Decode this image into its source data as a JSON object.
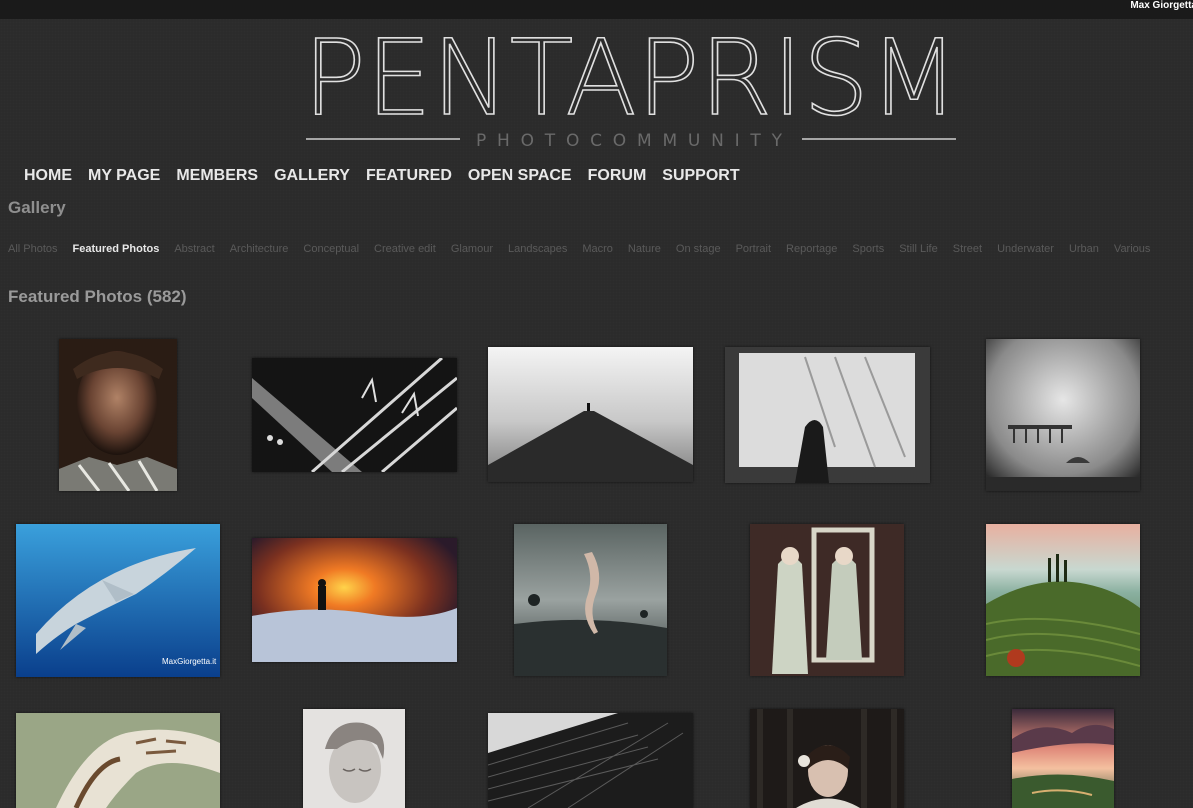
{
  "topbar": {
    "user_name": "Max Giorgetta"
  },
  "logo": {
    "brand": "PENTAPRISM",
    "tagline": "PHOTOCOMMUNITY"
  },
  "nav": {
    "items": [
      "HOME",
      "MY PAGE",
      "MEMBERS",
      "GALLERY",
      "FEATURED",
      "OPEN SPACE",
      "FORUM",
      "SUPPORT"
    ]
  },
  "gallery": {
    "title": "Gallery",
    "categories": [
      "All Photos",
      "Featured Photos",
      "Abstract",
      "Architecture",
      "Conceptual",
      "Creative edit",
      "Glamour",
      "Landscapes",
      "Macro",
      "Nature",
      "On stage",
      "Portrait",
      "Reportage",
      "Sports",
      "Still Life",
      "Street",
      "Underwater",
      "Urban",
      "Various"
    ],
    "active_category": "Featured Photos",
    "featured_title": "Featured Photos (582)"
  },
  "photos": [
    {
      "subject": "old-man-portrait"
    },
    {
      "subject": "street-arrows-bw"
    },
    {
      "subject": "pier-bw"
    },
    {
      "subject": "woman-frame-wall"
    },
    {
      "subject": "long-exposure-pier"
    },
    {
      "subject": "shark-underwater",
      "watermark": "MaxGiorgetta.it"
    },
    {
      "subject": "sunset-snow-photographer"
    },
    {
      "subject": "surreal-dancer-sea"
    },
    {
      "subject": "girls-mirror-frame"
    },
    {
      "subject": "tuscany-hills"
    },
    {
      "subject": "hawk-wings"
    },
    {
      "subject": "woman-portrait-soft"
    },
    {
      "subject": "skyscraper-bw"
    },
    {
      "subject": "girl-flower-dark"
    },
    {
      "subject": "sunset-clouds-landscape"
    }
  ]
}
